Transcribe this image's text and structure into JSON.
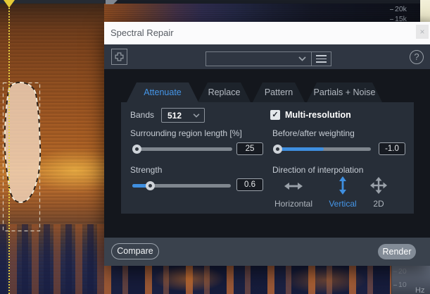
{
  "window": {
    "title": "Spectral Repair",
    "close_glyph": "×"
  },
  "toolbar": {
    "preset_value": "",
    "help_glyph": "?"
  },
  "tabs": [
    {
      "label": "Attenuate",
      "active": true
    },
    {
      "label": "Replace",
      "active": false
    },
    {
      "label": "Pattern",
      "active": false
    },
    {
      "label": "Partials + Noise",
      "active": false
    }
  ],
  "controls": {
    "bands": {
      "label": "Bands",
      "value": "512"
    },
    "multi_resolution": {
      "label": "Multi-resolution",
      "checked": true,
      "check_glyph": "✓"
    },
    "surrounding_region": {
      "label": "Surrounding region length [%]",
      "value": "25",
      "min_position": true
    },
    "before_after": {
      "label": "Before/after weighting",
      "value": "-1.0"
    },
    "strength": {
      "label": "Strength",
      "value": "0.6"
    },
    "direction": {
      "label": "Direction of interpolation",
      "options": [
        "Horizontal",
        "Vertical",
        "2D"
      ],
      "selected": "Vertical"
    }
  },
  "footer": {
    "compare_label": "Compare",
    "render_label": "Render"
  },
  "scales": {
    "top_freq": [
      "20k",
      "15k"
    ],
    "bottom_freq": [
      "20",
      "10"
    ],
    "unit": "Hz"
  },
  "colors": {
    "accent_blue": "#3f8fe0",
    "active_tab_text": "#4596e8",
    "playhead_yellow": "#e9d441"
  }
}
